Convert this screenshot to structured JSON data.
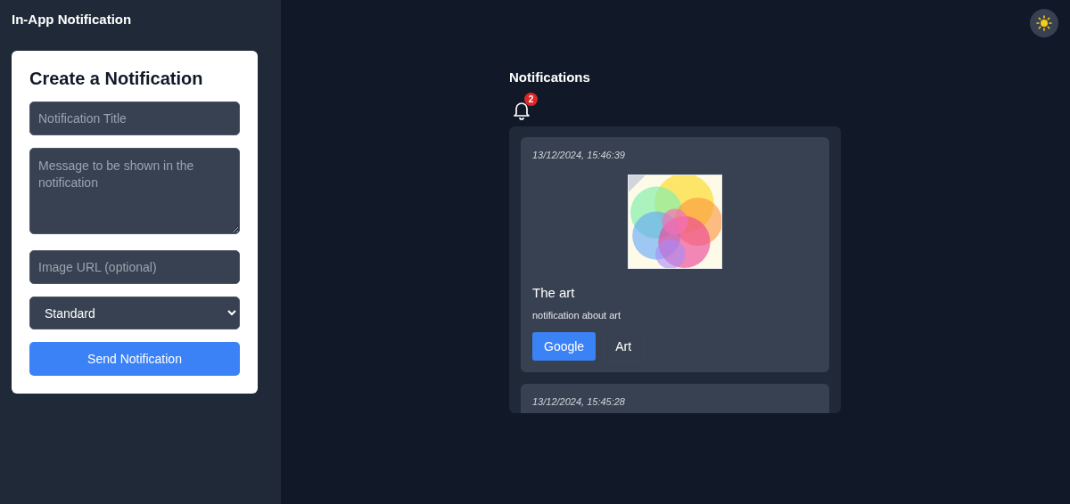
{
  "sidebar": {
    "title": "In-App Notification"
  },
  "form": {
    "heading": "Create a Notification",
    "fields": [
      {
        "kind": "input",
        "placeholder": "Notification Title"
      },
      {
        "kind": "textarea",
        "placeholder": "Message to be shown in the notification"
      },
      {
        "kind": "input",
        "placeholder": "Image URL (optional)"
      },
      {
        "kind": "select",
        "value": "Standard"
      }
    ],
    "submit": "Send Notification"
  },
  "notifications": {
    "heading": "Notifications",
    "badge": "2",
    "items": [
      {
        "time": "13/12/2024, 15:46:39",
        "title": "The art",
        "message": "notification about art",
        "actions": [
          {
            "label": "Google",
            "kind": "primary"
          },
          {
            "label": "Art",
            "kind": "secondary"
          }
        ]
      },
      {
        "time": "13/12/2024, 15:45:28"
      }
    ]
  }
}
